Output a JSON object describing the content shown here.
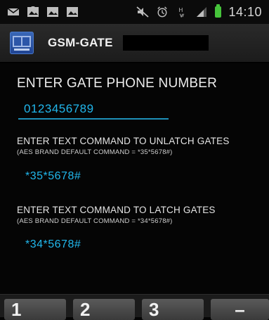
{
  "status_bar": {
    "time": "14:10",
    "icons": [
      "email-icon",
      "image-icon",
      "image-icon",
      "image-icon",
      "mute-icon",
      "alarm-icon",
      "hspa-icon",
      "signal-icon",
      "battery-icon"
    ]
  },
  "action_bar": {
    "title": "GSM-GATE"
  },
  "phone_section": {
    "label": "ENTER GATE PHONE NUMBER",
    "value": "0123456789"
  },
  "unlatch_section": {
    "label": "ENTER TEXT COMMAND TO UNLATCH GATES",
    "note": "(AES BRAND DEFAULT COMMAND = *35*5678#)",
    "value": "*35*5678#"
  },
  "latch_section": {
    "label": "ENTER TEXT COMMAND TO LATCH GATES",
    "note": "(AES BRAND DEFAULT COMMAND = *34*5678#)",
    "value": "*34*5678#"
  },
  "keyboard": {
    "keys": [
      "1",
      "2",
      "3",
      "–"
    ]
  },
  "colors": {
    "accent": "#21b7ec",
    "battery": "#46c43b",
    "app_icon": "#2c56a8"
  }
}
